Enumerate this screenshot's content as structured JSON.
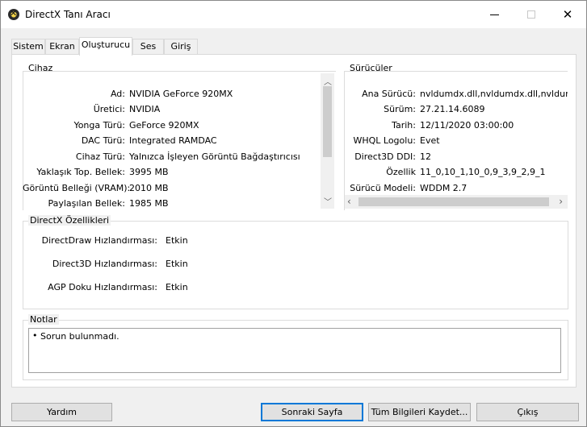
{
  "window": {
    "title": "DirectX Tanı Aracı"
  },
  "tabs": [
    "Sistem",
    "Ekran",
    "Oluşturucu",
    "Ses",
    "Giriş"
  ],
  "device": {
    "group_title": "Cihaz",
    "rows": [
      {
        "label": "Ad:",
        "value": "NVIDIA GeForce 920MX"
      },
      {
        "label": "Üretici:",
        "value": "NVIDIA"
      },
      {
        "label": "Yonga Türü:",
        "value": "GeForce 920MX"
      },
      {
        "label": "DAC Türü:",
        "value": "Integrated RAMDAC"
      },
      {
        "label": "Cihaz Türü:",
        "value": "Yalnızca İşleyen Görüntü Bağdaştırıcısı"
      },
      {
        "label": "Yaklaşık Top. Bellek:",
        "value": "3995 MB"
      },
      {
        "label": "Görüntü Belleği (VRAM):",
        "value": "2010 MB"
      },
      {
        "label": "Paylaşılan Bellek:",
        "value": "1985 MB"
      }
    ]
  },
  "drivers": {
    "group_title": "Sürücüler",
    "rows": [
      {
        "label": "Ana Sürücü:",
        "value": "nvldumdx.dll,nvldumdx.dll,nvldumdx.d"
      },
      {
        "label": "Sürüm:",
        "value": "27.21.14.6089"
      },
      {
        "label": "Tarih:",
        "value": "12/11/2020 03:00:00"
      },
      {
        "label": "WHQL Logolu:",
        "value": "Evet"
      },
      {
        "label": "Direct3D DDI:",
        "value": "12"
      },
      {
        "label": "Özellik",
        "value": "11_0,10_1,10_0,9_3,9_2,9_1"
      },
      {
        "label": "Sürücü Modeli:",
        "value": "WDDM 2.7"
      }
    ]
  },
  "features": {
    "group_title": "DirectX Özellikleri",
    "rows": [
      {
        "label": "DirectDraw Hızlandırması:",
        "value": "Etkin"
      },
      {
        "label": "Direct3D Hızlandırması:",
        "value": "Etkin"
      },
      {
        "label": "AGP Doku Hızlandırması:",
        "value": "Etkin"
      }
    ]
  },
  "notes": {
    "group_title": "Notlar",
    "bullet": "•",
    "text": "Sorun bulunmadı."
  },
  "buttons": {
    "help": "Yardım",
    "next_page": "Sonraki Sayfa",
    "save_all": "Tüm Bilgileri Kaydet...",
    "exit": "Çıkış"
  }
}
